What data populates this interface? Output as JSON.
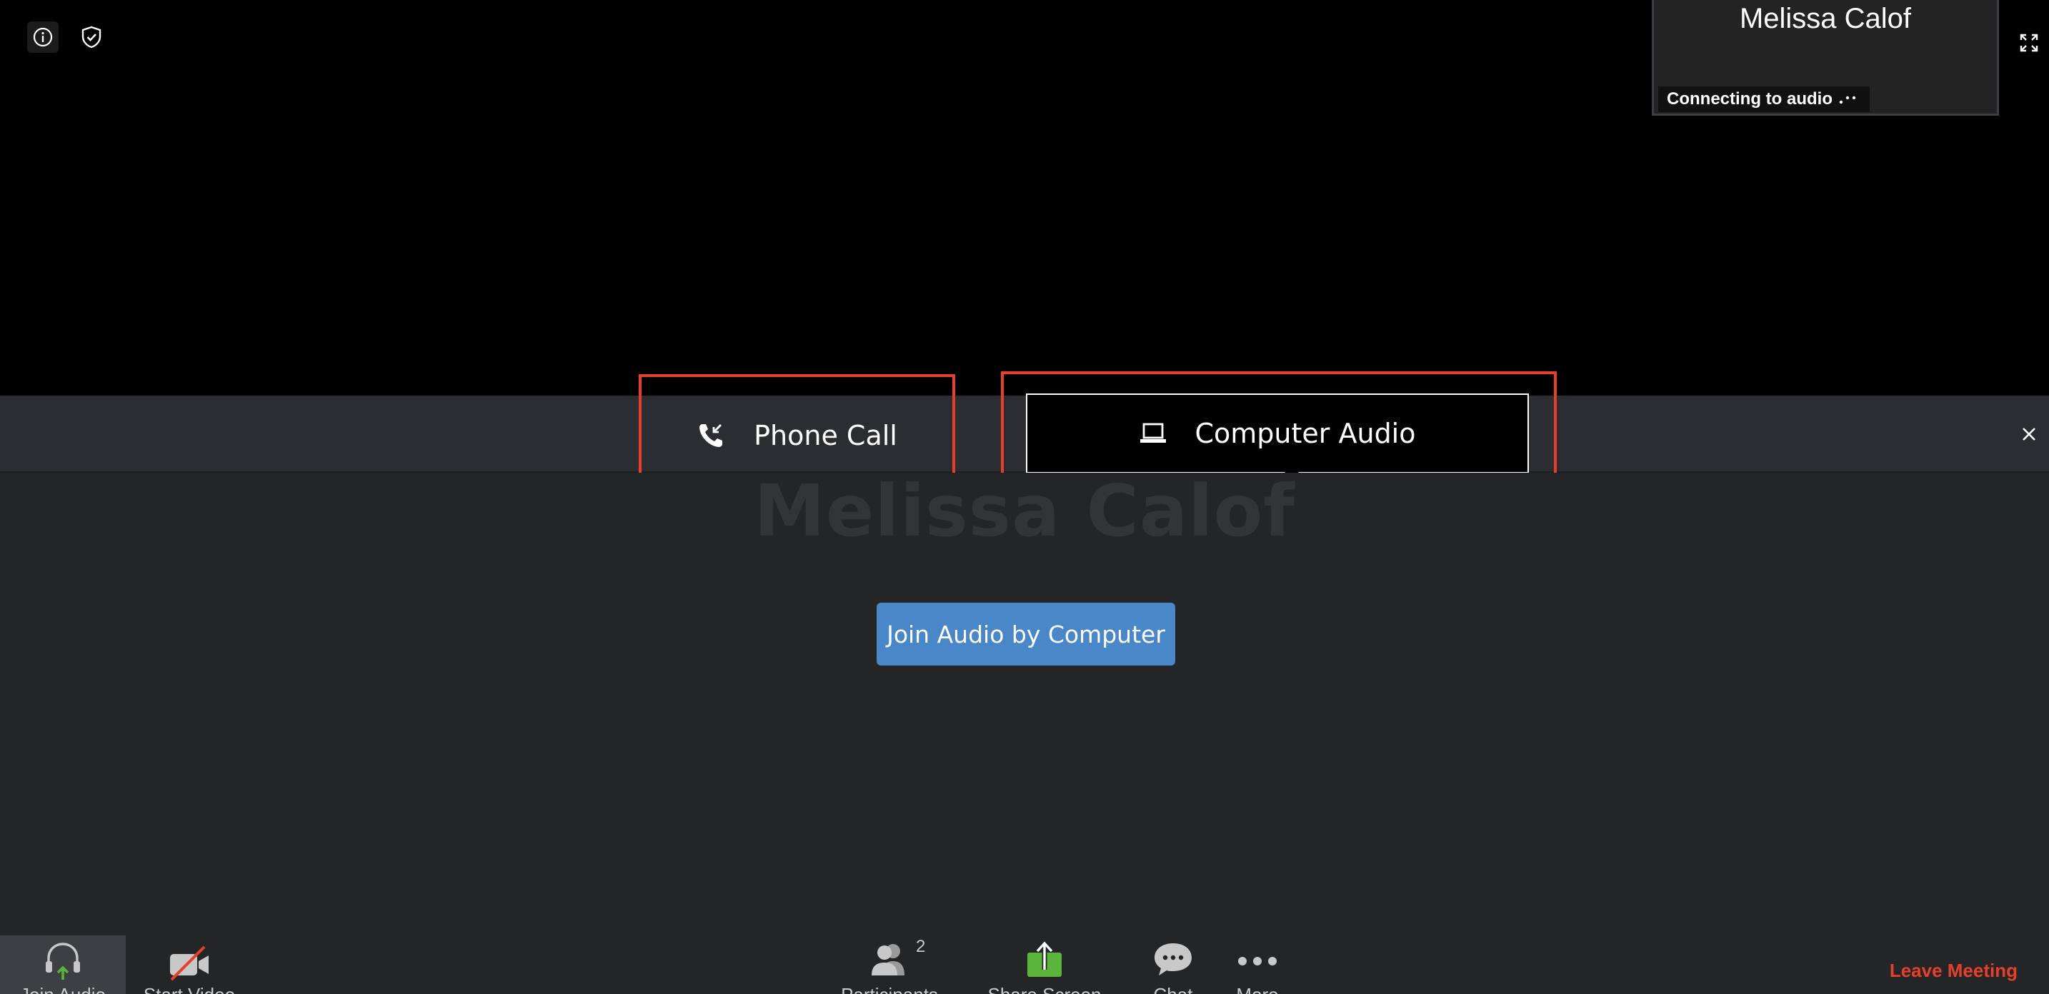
{
  "thumbnail": {
    "name": "Melissa Calof",
    "status": "Connecting to audio"
  },
  "audio_options": {
    "phone_call": "Phone Call",
    "computer_audio": "Computer Audio"
  },
  "main": {
    "participant_name": "Melissa Calof",
    "join_button": "Join Audio by Computer"
  },
  "toolbar": {
    "join_audio": "Join Audio",
    "start_video": "Start Video",
    "participants": "Participants",
    "participants_count": "2",
    "share_screen": "Share Screen",
    "chat": "Chat",
    "more": "More",
    "leave": "Leave Meeting"
  },
  "icons": {
    "info": "info-icon",
    "shield": "shield-icon",
    "fullscreen": "fullscreen-icon",
    "phone": "phone-icon",
    "laptop": "laptop-icon",
    "close": "close-icon",
    "headphones": "headphones-icon",
    "video_off": "video-off-icon",
    "participants": "participants-icon",
    "share": "share-screen-icon",
    "chat": "chat-icon",
    "more": "more-icon"
  },
  "colors": {
    "highlight": "#e5402b",
    "join_button": "#4a87c9",
    "leave": "#e5402b",
    "share_green": "#5bb43c"
  }
}
